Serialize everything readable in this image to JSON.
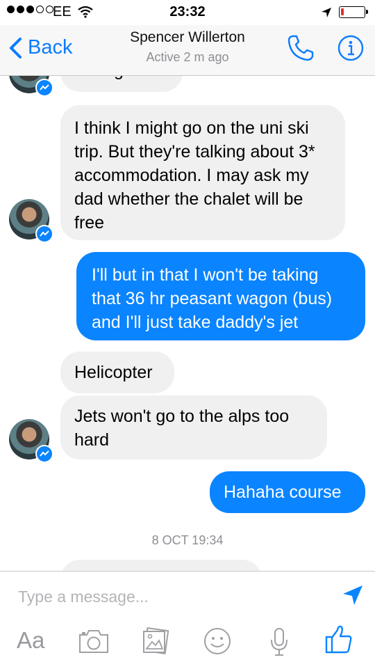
{
  "status_bar": {
    "carrier": "EE",
    "time": "23:32",
    "battery_level": 0.12,
    "signal_bars": 3
  },
  "header": {
    "back_label": "Back",
    "contact_name": "Spencer Willerton",
    "status": "Active 2 m ago"
  },
  "messages": [
    {
      "from": "them",
      "text": "Thought so"
    },
    {
      "from": "them",
      "text": "I think I might go on the uni ski trip. But they're talking about 3* accommodation. I may ask my dad whether the chalet will be free"
    },
    {
      "from": "me",
      "text": "I'll but in that I won't be taking that 36 hr peasant wagon (bus) and I'll just take daddy's jet"
    },
    {
      "from": "them",
      "text": "Helicopter"
    },
    {
      "from": "them",
      "text": "Jets won't go to the alps too hard"
    },
    {
      "from": "me",
      "text": "Hahaha course"
    }
  ],
  "date_separator": "8 OCT 19:34",
  "composer": {
    "placeholder": "Type a message...",
    "aa_label": "Aa"
  },
  "colors": {
    "accent": "#0a84ff",
    "incoming_bubble": "#f1f0f0",
    "outgoing_bubble": "#0a84ff",
    "muted_text": "#8e8e93"
  },
  "icons": [
    "back-chevron-icon",
    "phone-icon",
    "info-icon",
    "send-icon",
    "camera-icon",
    "photo-icon",
    "emoji-icon",
    "microphone-icon",
    "like-icon",
    "messenger-badge-icon"
  ]
}
